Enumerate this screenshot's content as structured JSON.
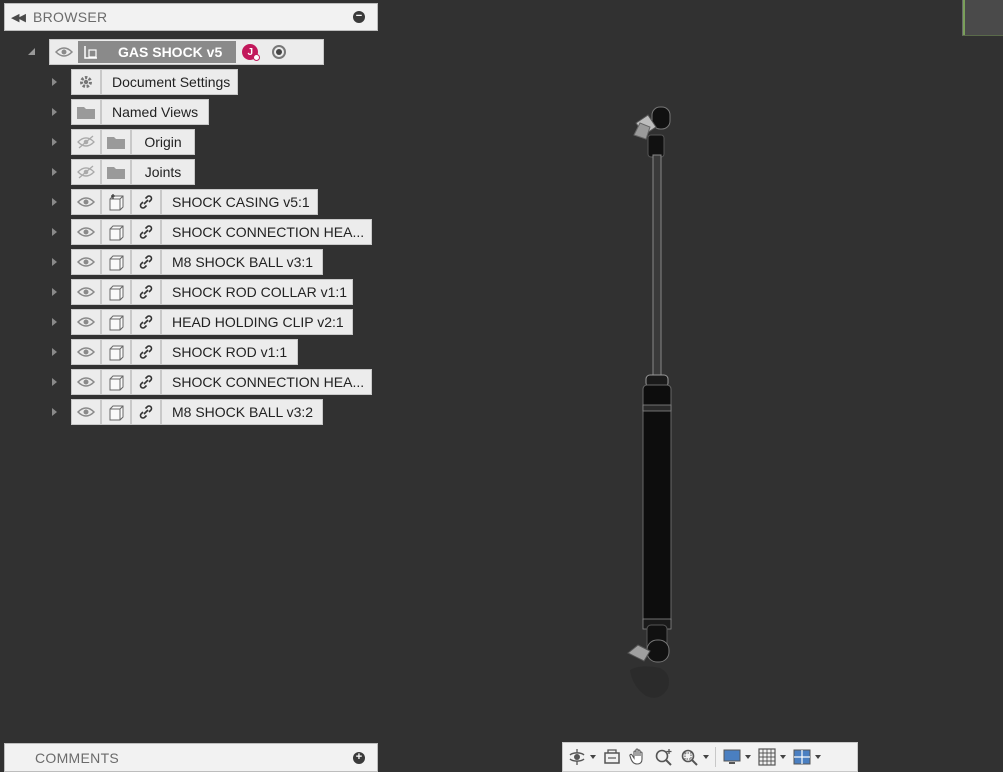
{
  "browser": {
    "title": "BROWSER",
    "root": {
      "name": "GAS SHOCK v5",
      "avatar_initial": "J"
    },
    "items": [
      {
        "label": "Document Settings"
      },
      {
        "label": "Named Views"
      },
      {
        "label": "Origin"
      },
      {
        "label": "Joints"
      },
      {
        "label": "SHOCK CASING v5:1"
      },
      {
        "label": "SHOCK CONNECTION HEA..."
      },
      {
        "label": "M8 SHOCK BALL v3:1"
      },
      {
        "label": "SHOCK ROD COLLAR v1:1"
      },
      {
        "label": "HEAD HOLDING CLIP v2:1"
      },
      {
        "label": "SHOCK ROD v1:1"
      },
      {
        "label": "SHOCK CONNECTION HEA..."
      },
      {
        "label": "M8 SHOCK BALL v3:2"
      }
    ]
  },
  "comments": {
    "title": "COMMENTS"
  },
  "toolbar": {
    "tools": [
      "orbit-icon",
      "look-at-icon",
      "pan-icon",
      "zoom-icon",
      "fit-icon",
      "display-settings-icon",
      "grid-icon",
      "viewports-icon"
    ]
  },
  "colors": {
    "viewport_bg": "#313131",
    "avatar": "#c2185b",
    "panel_bg": "#ececec"
  }
}
